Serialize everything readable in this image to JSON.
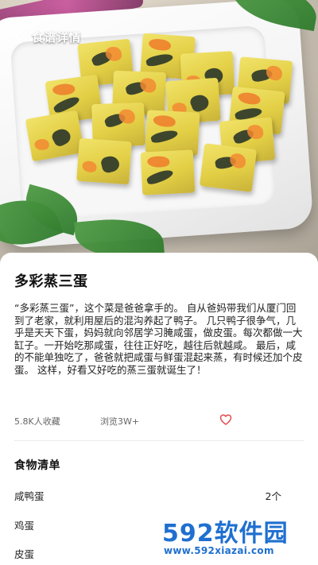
{
  "header": {
    "title": "食谱详情"
  },
  "recipe": {
    "title": "多彩蒸三蛋",
    "description": "“多彩蒸三蛋”，这个菜是爸爸拿手的。 自从爸妈带我们从厦门回到了老家，就利用屋后的混沟养起了鸭子。 几只鸭子很争气，几乎是天天下蛋，妈妈就向邻居学习腌咸蛋，做皮蛋。每次都做一大缸子。一开始吃那咸蛋，往往正好吃，越往后就越咸。 最后，咸的不能单独吃了，爸爸就把咸蛋与鲜蛋混起来蒸，有时候还加个皮蛋。 这样，好看又好吃的蒸三蛋就诞生了！",
    "favorites": "5.8K人收藏",
    "views": "浏览3W+"
  },
  "ingredients": {
    "section_title": "食物清单",
    "items": [
      {
        "name": "咸鸭蛋",
        "amount": "2个"
      },
      {
        "name": "鸡蛋",
        "amount": ""
      },
      {
        "name": "皮蛋",
        "amount": ""
      }
    ]
  },
  "watermark": {
    "logo_num": "592",
    "logo_text": "软件园",
    "url": "www.592xiazai.com"
  },
  "colors": {
    "accent_heart": "#e5484d",
    "watermark_blue": "#1f6fd0"
  },
  "icons": {
    "back": "chevron-left-icon",
    "favorite": "heart-outline-icon"
  }
}
